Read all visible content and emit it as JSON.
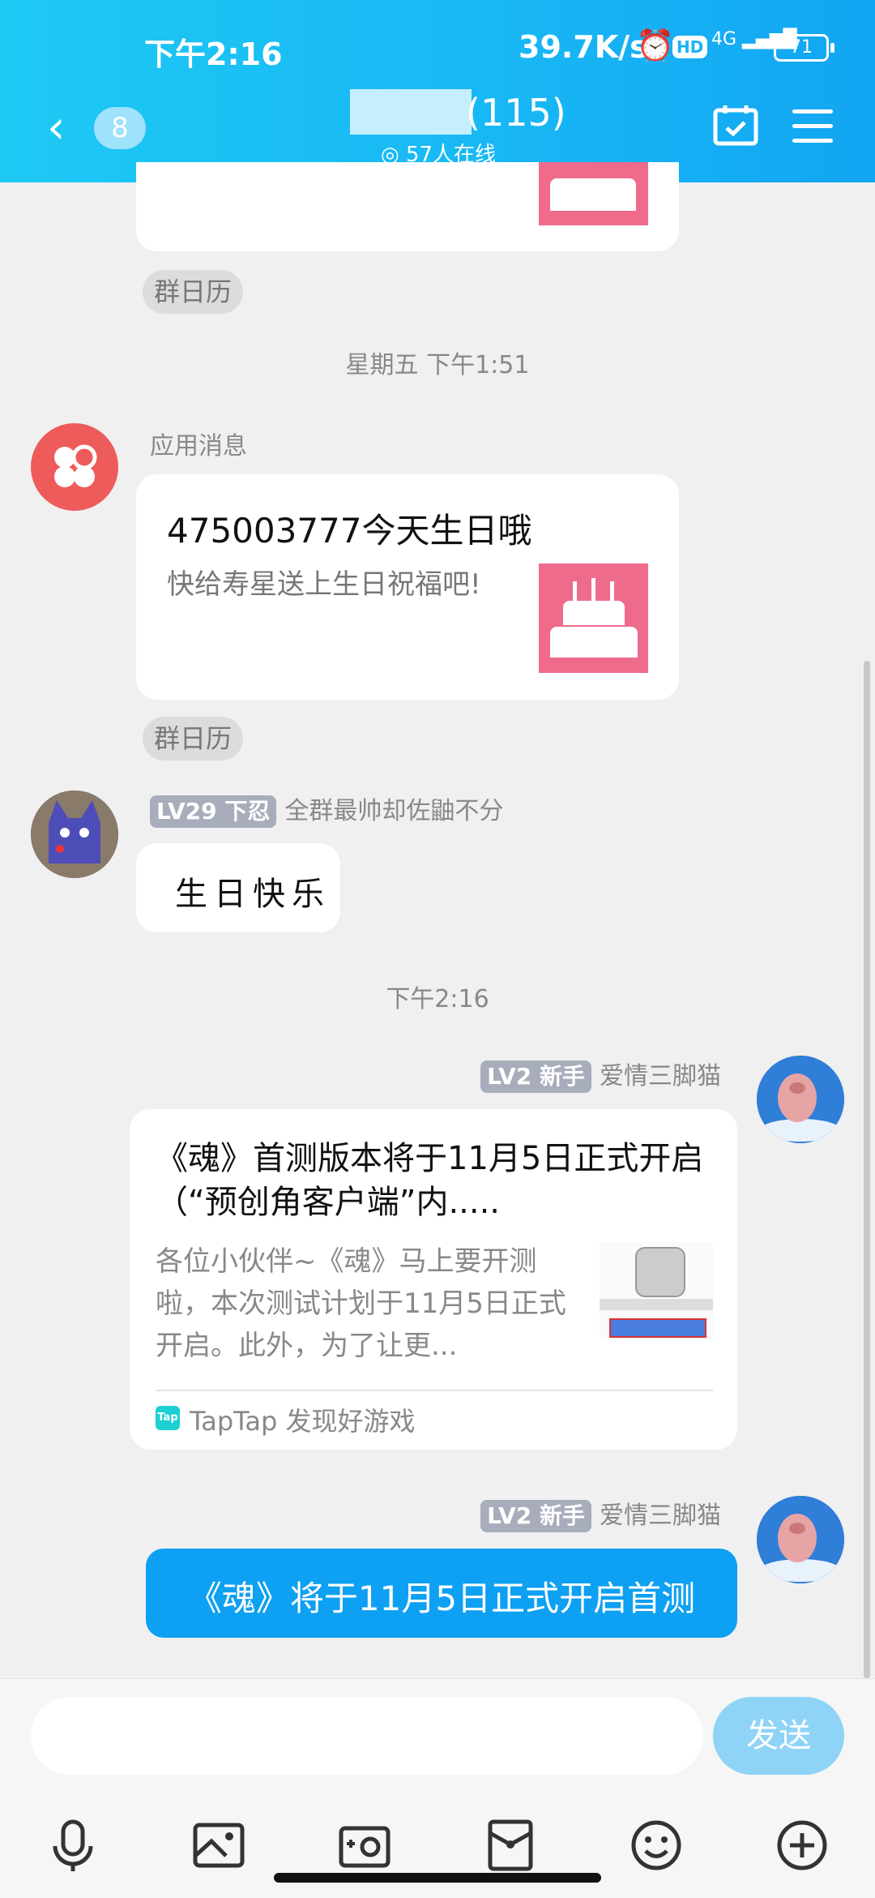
{
  "status_bar": {
    "time": "下午2:16",
    "net_speed": "39.7K/s",
    "hd": "HD",
    "signal": "4G",
    "battery": "71"
  },
  "nav": {
    "unread_count": "8",
    "title_count": "(115)",
    "online": "57人在线"
  },
  "messages": {
    "tag1": "群日历",
    "time1": "星期五 下午1:51",
    "app_sender": "应用消息",
    "bday_title": "475003777今天生日哦",
    "bday_sub": "快给寿星送上生日祝福吧!",
    "tag2": "群日历",
    "user1_level": "LV29 下忍",
    "user1_name": "全群最帅却佐鼬不分",
    "user1_msg": "生日快乐",
    "time2": "下午2:16",
    "user2_level": "LV2 新手",
    "user2_name": "爱情三脚猫",
    "link_title": "《魂》首测版本将于11月5日正式开启（“预创角客户端”内.....",
    "link_desc": "各位小伙伴~《魂》马上要开测啦，本次测试计划于11月5日正式开启。此外，为了让更...",
    "link_source": "TapTap 发现好游戏",
    "tap_logo": "Tap",
    "user3_level": "LV2 新手",
    "user3_name": "爱情三脚猫",
    "user3_msg": "《魂》将于11月5日正式开启首测"
  },
  "input": {
    "send_label": "发送"
  },
  "colors": {
    "header": "#18b6f5",
    "own_bubble": "#0ea0f2",
    "send_button": "#8fd3f7"
  }
}
